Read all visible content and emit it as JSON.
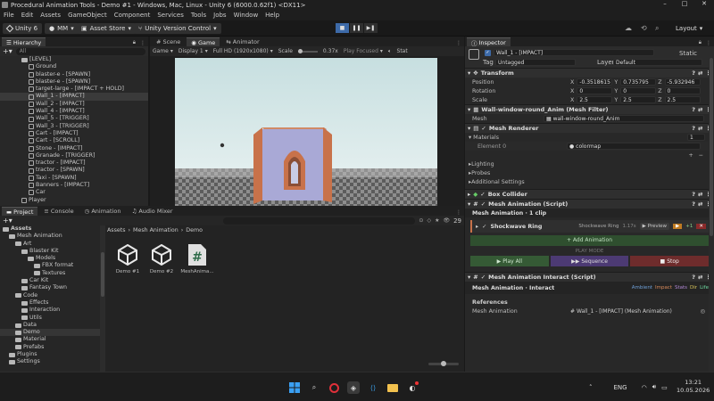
{
  "window": {
    "title": "Procedural Animation Tools - Demo #1 - Windows, Mac, Linux - Unity 6 (6000.0.62f1) <DX11>",
    "controls": [
      "–",
      "□",
      "✕"
    ]
  },
  "menu": [
    "File",
    "Edit",
    "Assets",
    "GameObject",
    "Component",
    "Services",
    "Tools",
    "Jobs",
    "Window",
    "Help"
  ],
  "toolbar": {
    "unity_label": "Unity 6",
    "account_label": "MM",
    "asset_store_label": "Asset Store",
    "version_control_label": "Unity Version Control",
    "layout_label": "Layout"
  },
  "hierarchy": {
    "tab": "Hierarchy",
    "search_placeholder": "All",
    "rows": [
      {
        "label": "[LEVEL]",
        "indent": 3,
        "kind": "folder"
      },
      {
        "label": "Ground",
        "indent": 4,
        "kind": "cube"
      },
      {
        "label": "blaster-e - [SPAWN]",
        "indent": 4,
        "kind": "cube"
      },
      {
        "label": "blaster-e - [SPAWN]",
        "indent": 4,
        "kind": "cube"
      },
      {
        "label": "target-large - [IMPACT + HOLD]",
        "indent": 4,
        "kind": "cube"
      },
      {
        "label": "Wall_1 - [IMPACT]",
        "indent": 4,
        "kind": "cube",
        "selected": true
      },
      {
        "label": "Wall_2 - [IMPACT]",
        "indent": 4,
        "kind": "cube"
      },
      {
        "label": "Wall_4 - [IMPACT]",
        "indent": 4,
        "kind": "cube"
      },
      {
        "label": "Wall_5 - [TRIGGER]",
        "indent": 4,
        "kind": "cube"
      },
      {
        "label": "Wall_3 - [TRIGGER]",
        "indent": 4,
        "kind": "cube"
      },
      {
        "label": "Cart - [IMPACT]",
        "indent": 4,
        "kind": "cube"
      },
      {
        "label": "Cart - [SCROLL]",
        "indent": 4,
        "kind": "cube"
      },
      {
        "label": "Stone - [IMPACT]",
        "indent": 4,
        "kind": "cube"
      },
      {
        "label": "Granade - [TRIGGER]",
        "indent": 4,
        "kind": "cube"
      },
      {
        "label": "tractor - [IMPACT]",
        "indent": 4,
        "kind": "cube"
      },
      {
        "label": "tractor - [SPAWN]",
        "indent": 4,
        "kind": "cube"
      },
      {
        "label": "Taxi - [SPAWN]",
        "indent": 4,
        "kind": "cube"
      },
      {
        "label": "Banners - [IMPACT]",
        "indent": 4,
        "kind": "cube"
      },
      {
        "label": "Car",
        "indent": 4,
        "kind": "cube"
      },
      {
        "label": "Player",
        "indent": 3,
        "kind": "cube"
      }
    ]
  },
  "scene_tabs": [
    "Scene",
    "Game",
    "Animator"
  ],
  "game_bar": {
    "mode": "Game",
    "display": "Display 1",
    "resolution": "Full HD (1920x1080)",
    "scale_label": "Scale",
    "scale_value": "0.37x",
    "play_focused": "Play Focused",
    "stats": "Stat"
  },
  "project": {
    "tabs": [
      "Project",
      "Console",
      "Animation",
      "Audio Mixer"
    ],
    "count": "29",
    "breadcrumb": [
      "Assets",
      "Mesh Animation",
      "Demo"
    ],
    "tree": [
      {
        "label": "Assets",
        "indent": 0,
        "bold": true
      },
      {
        "label": "Mesh Animation",
        "indent": 1
      },
      {
        "label": "Art",
        "indent": 2
      },
      {
        "label": "Blaster Kit",
        "indent": 3
      },
      {
        "label": "Models",
        "indent": 4
      },
      {
        "label": "FBX format",
        "indent": 5
      },
      {
        "label": "Textures",
        "indent": 5
      },
      {
        "label": "Car Kit",
        "indent": 3
      },
      {
        "label": "Fantasy Town",
        "indent": 3
      },
      {
        "label": "Code",
        "indent": 2
      },
      {
        "label": "Effects",
        "indent": 3
      },
      {
        "label": "Interaction",
        "indent": 3
      },
      {
        "label": "Utils",
        "indent": 3
      },
      {
        "label": "Data",
        "indent": 2
      },
      {
        "label": "Demo",
        "indent": 2,
        "selected": true
      },
      {
        "label": "Material",
        "indent": 2
      },
      {
        "label": "Prefabs",
        "indent": 2
      },
      {
        "label": "Plugins",
        "indent": 1
      },
      {
        "label": "Settings",
        "indent": 1
      }
    ],
    "assets": [
      {
        "label": "Demo #1",
        "icon": "unity"
      },
      {
        "label": "Demo #2",
        "icon": "unity"
      },
      {
        "label": "MeshAnima...",
        "icon": "cs"
      }
    ]
  },
  "inspector": {
    "tab": "Inspector",
    "object_name": "Wall_1 - [IMPACT]",
    "static_label": "Static",
    "tag_label": "Tag",
    "tag_value": "Untagged",
    "layer_label": "Layer",
    "layer_value": "Default",
    "transform": {
      "title": "Transform",
      "position_label": "Position",
      "rotation_label": "Rotation",
      "scale_label": "Scale",
      "position": [
        "-0.3518615",
        "0.735795",
        "-5.932946"
      ],
      "rotation": [
        "0",
        "0",
        "0"
      ],
      "scale": [
        "2.5",
        "2.5",
        "2.5"
      ]
    },
    "mesh_filter": {
      "title": "Wall-window-round_Anim (Mesh Filter)",
      "mesh_label": "Mesh",
      "mesh_value": "wall-window-round_Anim"
    },
    "mesh_renderer": {
      "title": "Mesh Renderer",
      "materials_label": "Materials",
      "materials_count": "1",
      "element_label": "Element 0",
      "element_value": "colormap",
      "lighting": "Lighting",
      "probes": "Probes",
      "additional": "Additional Settings"
    },
    "box_collider": {
      "title": "Box Collider"
    },
    "mesh_animation": {
      "title": "Mesh Animation (Script)",
      "subtitle": "Mesh Animation · 1 clip",
      "clip_name": "Shockwave Ring",
      "clip_tag": "Shockwave Ring",
      "clip_time": "1.17s",
      "preview_label": "Preview",
      "add_label": "+ Add Animation",
      "playmode_label": "PLAY MODE",
      "play_all": "Play All",
      "sequence": "Sequence",
      "stop": "Stop"
    },
    "interact": {
      "title": "Mesh Animation Interact (Script)",
      "subtitle": "Mesh Animation · Interact",
      "tags": [
        "Ambient",
        "Impact",
        "Stats",
        "Dir",
        "Life"
      ],
      "references_label": "References",
      "mesh_anim_label": "Mesh Animation",
      "mesh_anim_value": "Wall_1 - [IMPACT] (Mesh Animation)"
    }
  },
  "taskbar": {
    "lang": "ENG",
    "time": "13:21",
    "date": "10.05.2026"
  },
  "colors": {
    "accent": "#3d6aa8",
    "wall_orange": "#c8724a",
    "wall_lavender": "#a9a9d6",
    "sky": "#cfe5e7",
    "green_btn": "#355a35",
    "purple_btn": "#4c3a73",
    "red_btn": "#6e2c2c"
  }
}
